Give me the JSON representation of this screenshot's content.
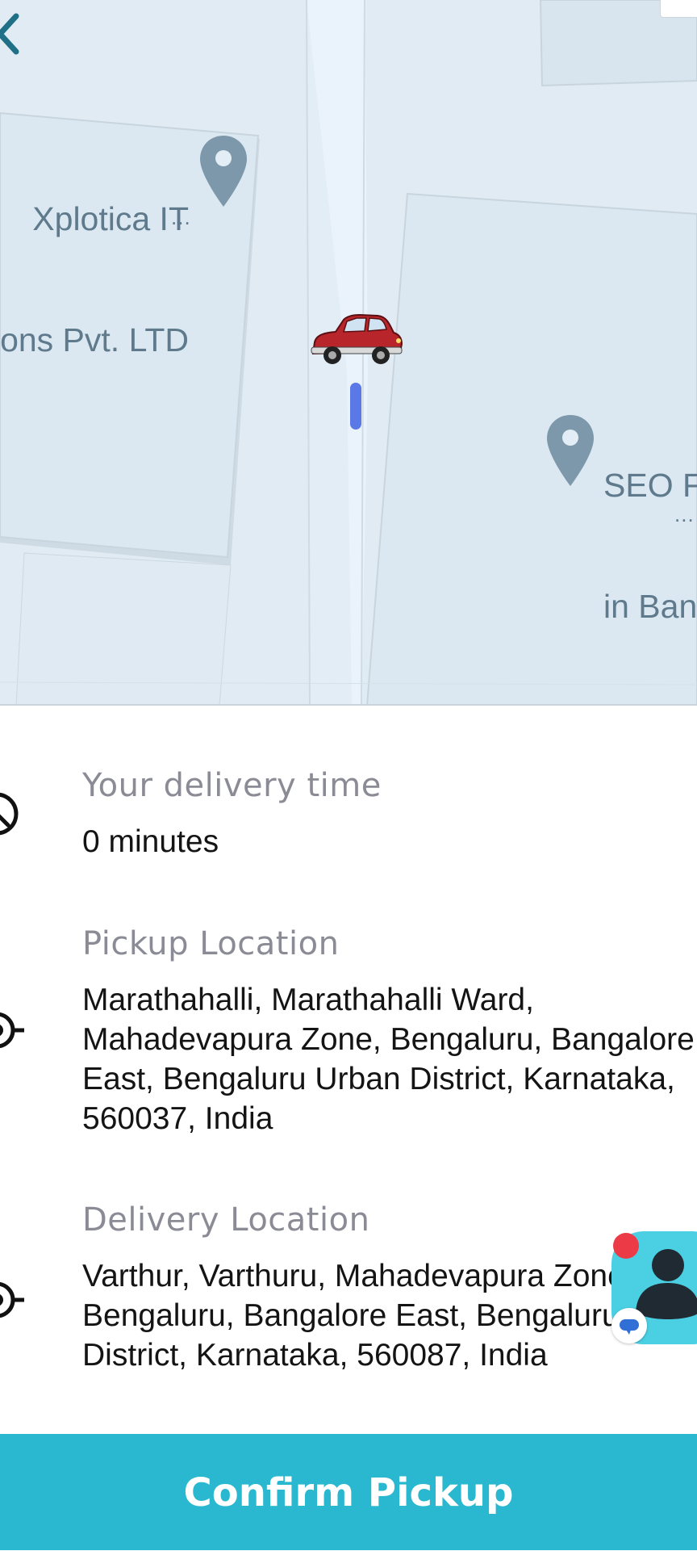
{
  "map": {
    "poi_1": {
      "name_line1": "Xplotica IT",
      "name_line2": "ons Pvt. LTD",
      "more": "..."
    },
    "poi_2": {
      "name_line1": "SEO Fr",
      "name_line2": "in Ban",
      "more": "..."
    },
    "icons": {
      "back": "back-arrow-icon",
      "pin": "map-pin-icon",
      "vehicle": "car-icon",
      "location": "location-marker-icon"
    },
    "colors": {
      "map_background": "#e3edf5",
      "road": "#eaf3fb",
      "building": "#dce8f1",
      "pin": "#7c98aa",
      "route_marker": "#5a78e6"
    }
  },
  "delivery_time": {
    "title": "Your delivery time",
    "value": "0 minutes"
  },
  "pickup": {
    "title": "Pickup Location",
    "lines": [
      "Marathahalli, Marathahalli Ward,",
      "Mahadevapura Zone, Bengaluru, Bangalore",
      "East, Bengaluru Urban District, Karnataka,",
      "560037, India"
    ]
  },
  "delivery": {
    "title": "Delivery Location",
    "lines": [
      "Varthur, Varthuru, Mahadevapura Zone,",
      "Bengaluru, Bangalore East, Bengaluru Urban",
      "District, Karnataka, 560087, India"
    ]
  },
  "assistant": {
    "icon": "support-agent-icon",
    "badge_color": "#ec3b46",
    "background": "#4bcfe3"
  },
  "actions": {
    "confirm_label": "Confirm Pickup",
    "confirm_color": "#29b8cf"
  }
}
